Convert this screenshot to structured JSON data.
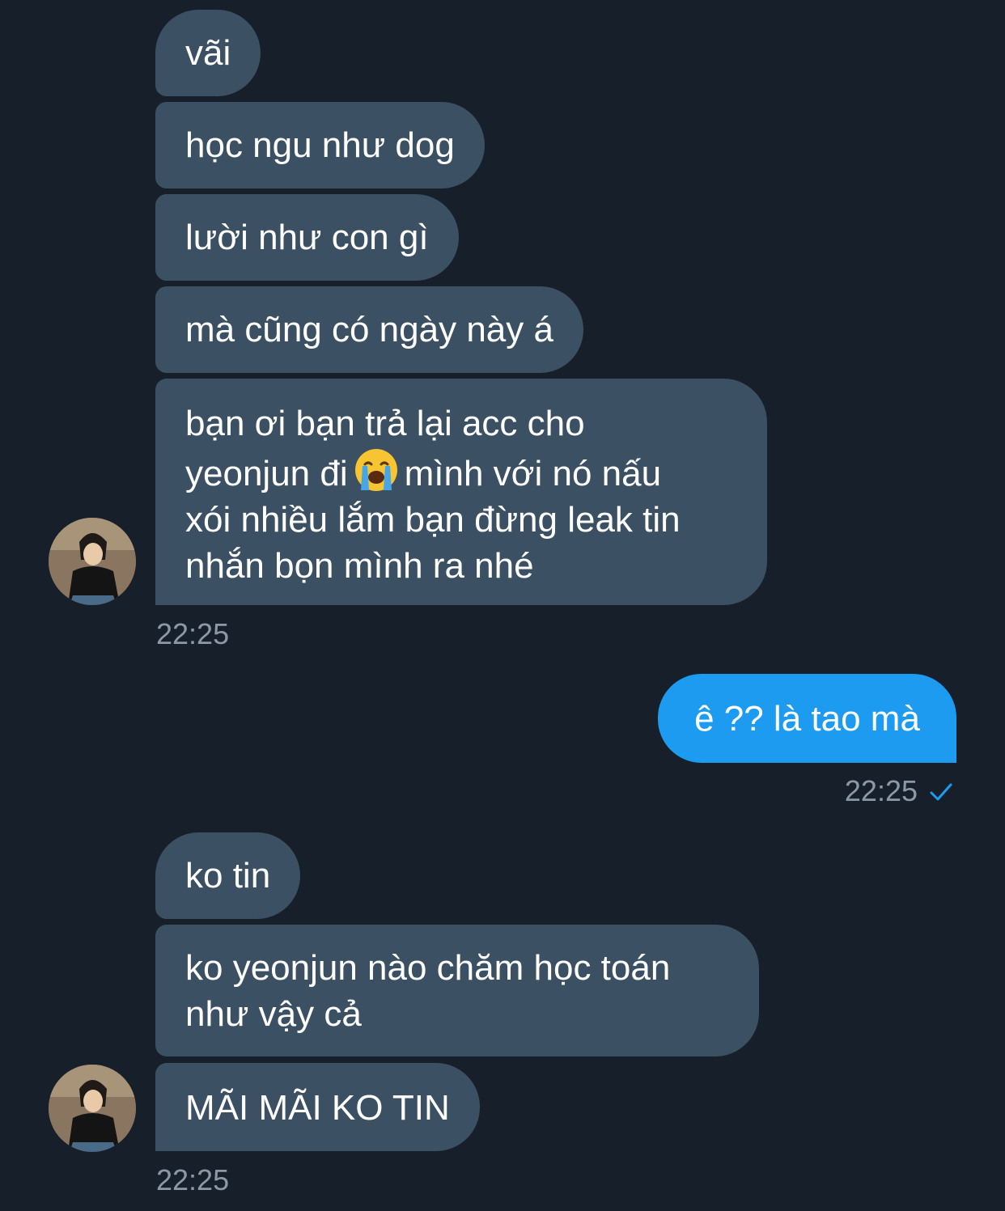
{
  "conversation": {
    "messages": [
      {
        "text": "vãi"
      },
      {
        "text": "học ngu như dog"
      },
      {
        "text": "lười như con gì"
      },
      {
        "text": "mà cũng có ngày này á"
      },
      {
        "lines": [
          "bạn ơi bạn trả lại acc cho",
          "yeonjun đi",
          "mình với nó nấu",
          "xói nhiều lắm bạn đừng leak tin",
          "nhắn bọn mình ra nhé"
        ],
        "emoji": "loudly-crying-face"
      },
      {
        "text": "ê ?? là tao mà"
      },
      {
        "text": "ko tin"
      },
      {
        "lines": [
          "ko yeonjun nào chăm học toán",
          "như vậy cả"
        ]
      },
      {
        "text": "MÃI MÃI KO TIN"
      }
    ],
    "timestamps": [
      "22:25",
      "22:25",
      "22:25"
    ],
    "sent_status_icon": "checkmark-icon",
    "colors": {
      "background": "#17202a",
      "incoming_bubble": "#3b5063",
      "outgoing_bubble": "#1d9bf0",
      "timestamp": "#8b98a5"
    }
  }
}
